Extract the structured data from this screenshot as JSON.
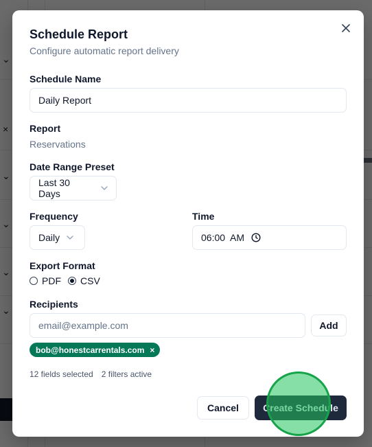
{
  "modal": {
    "title": "Schedule Report",
    "description": "Configure automatic report delivery",
    "close_icon": "x-icon"
  },
  "schedule_name": {
    "label": "Schedule Name",
    "value": "Daily Report"
  },
  "report": {
    "label": "Report",
    "value": "Reservations"
  },
  "date_range": {
    "label": "Date Range Preset",
    "value": "Last 30 Days",
    "icon": "chevron-down-icon"
  },
  "frequency": {
    "label": "Frequency",
    "value": "Daily",
    "icon": "chevron-down-icon"
  },
  "time": {
    "label": "Time",
    "value": "06:00  AM",
    "icon": "clock-icon"
  },
  "export_format": {
    "label": "Export Format",
    "options": [
      {
        "label": "PDF",
        "checked": false
      },
      {
        "label": "CSV",
        "checked": true
      }
    ]
  },
  "recipients": {
    "label": "Recipients",
    "placeholder": "email@example.com",
    "add_label": "Add",
    "chips": [
      {
        "email": "bob@honestcarrentals.com",
        "remove": "×"
      }
    ]
  },
  "stats": {
    "fields": "12 fields selected",
    "filters": "2 filters active"
  },
  "actions": {
    "cancel_label": "Cancel",
    "create_label": "Create Schedule"
  },
  "colors": {
    "primary": "#1e293b",
    "chip": "#047857",
    "click_indicator": "#22c55e"
  }
}
